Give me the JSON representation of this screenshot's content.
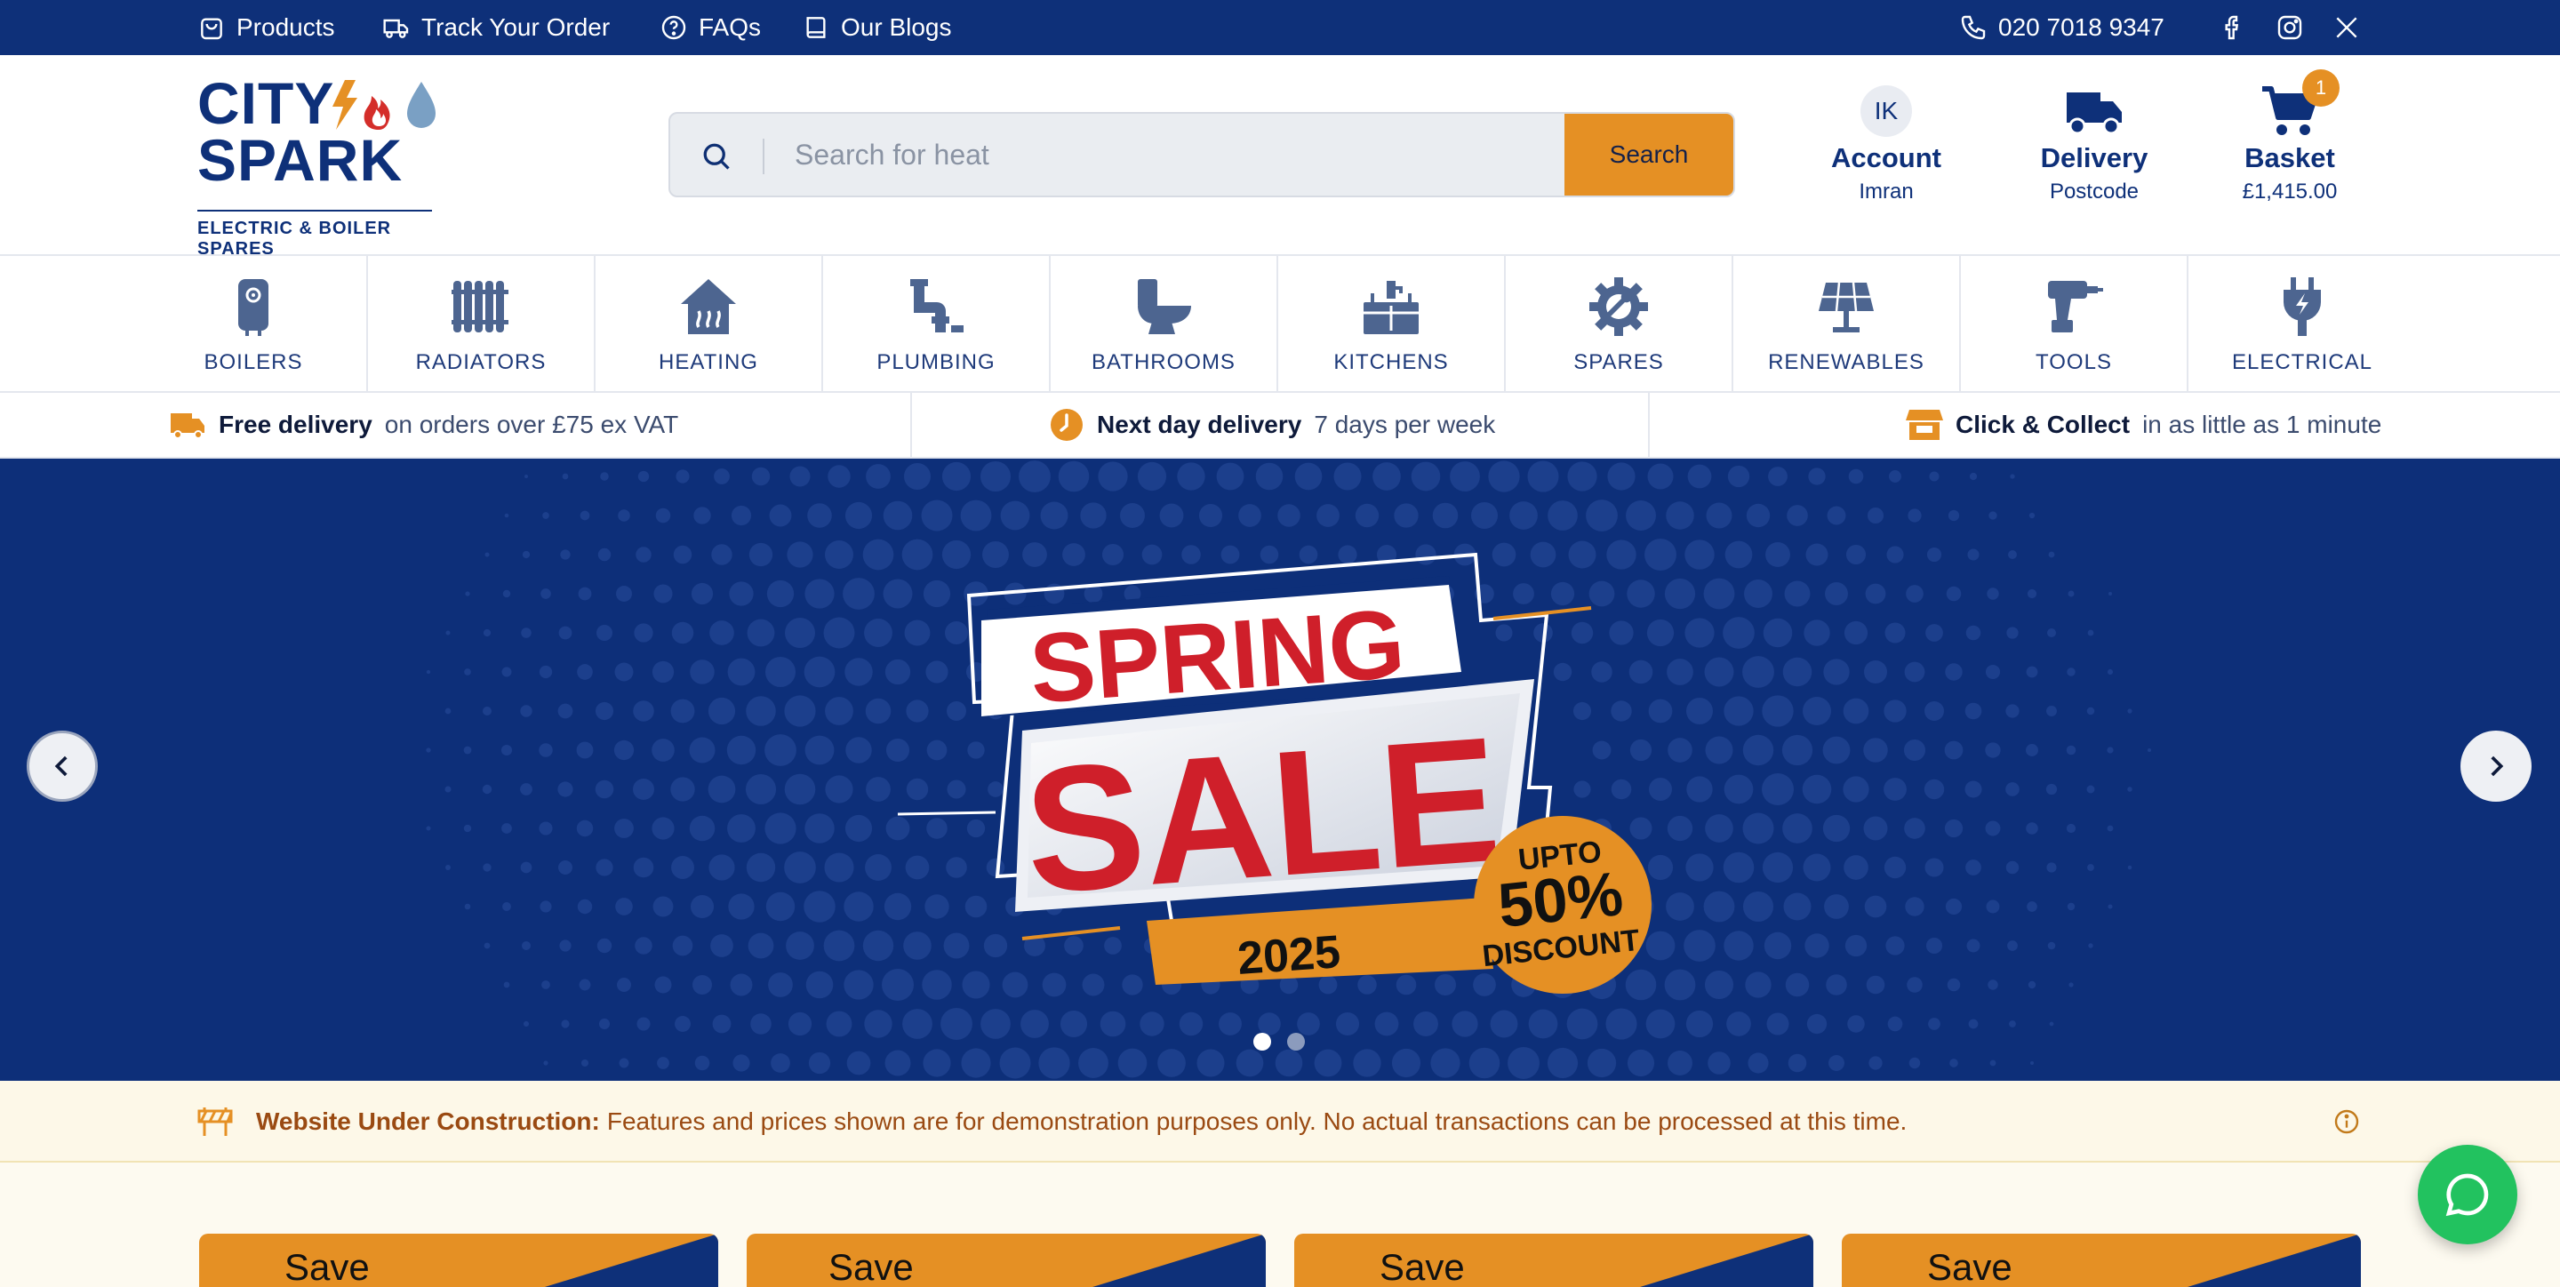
{
  "topbar": {
    "links": [
      {
        "label": "Products",
        "icon": "bag-icon"
      },
      {
        "label": "Track Your Order",
        "icon": "truck-icon"
      },
      {
        "label": "FAQs",
        "icon": "question-icon"
      },
      {
        "label": "Our Blogs",
        "icon": "book-icon"
      }
    ],
    "phone": "020 7018 9347",
    "social": [
      "facebook-icon",
      "instagram-icon",
      "x-icon"
    ]
  },
  "brand": {
    "line1": "CITY",
    "line2": "SPARK",
    "tagline": "ELECTRIC & BOILER SPARES",
    "colors": {
      "navy": "#0e3079",
      "orange": "#e59024",
      "red": "#d42e2a",
      "drop": "#7aa0c4"
    }
  },
  "search": {
    "placeholder": "Search for heat",
    "button": "Search"
  },
  "account": {
    "initials": "IK",
    "label": "Account",
    "name": "Imran"
  },
  "delivery": {
    "label": "Delivery",
    "sub": "Postcode"
  },
  "basket": {
    "label": "Basket",
    "total": "£1,415.00",
    "count": "1"
  },
  "categories": [
    {
      "label": "BOILERS",
      "icon": "boiler-icon"
    },
    {
      "label": "RADIATORS",
      "icon": "radiator-icon"
    },
    {
      "label": "HEATING",
      "icon": "heating-icon"
    },
    {
      "label": "PLUMBING",
      "icon": "pipe-icon"
    },
    {
      "label": "BATHROOMS",
      "icon": "toilet-icon"
    },
    {
      "label": "KITCHENS",
      "icon": "sink-icon"
    },
    {
      "label": "SPARES",
      "icon": "cog-wrench-icon"
    },
    {
      "label": "RENEWABLES",
      "icon": "solar-panel-icon"
    },
    {
      "label": "TOOLS",
      "icon": "drill-icon"
    },
    {
      "label": "ELECTRICAL",
      "icon": "plug-icon"
    }
  ],
  "usp": [
    {
      "title": "Free delivery",
      "sub": "on orders over £75 ex VAT",
      "icon": "truck-icon"
    },
    {
      "title": "Next day delivery",
      "sub": "7 days per week",
      "icon": "clock-icon"
    },
    {
      "title": "Click & Collect",
      "sub": "in as little as 1 minute",
      "icon": "store-icon"
    }
  ],
  "banner": {
    "word1": "SPRING",
    "word2": "SALE",
    "year": "2025",
    "badge_line1": "UPTO",
    "badge_line2": "50%",
    "badge_line3": "DISCOUNT",
    "slides": 2,
    "active_slide": 1
  },
  "notice": {
    "title": "Website Under Construction:",
    "text": "Features and prices shown are for demonstration purposes only. No actual transactions can be processed at this time."
  },
  "cards": [
    "Save",
    "Save",
    "Save",
    "Save"
  ]
}
